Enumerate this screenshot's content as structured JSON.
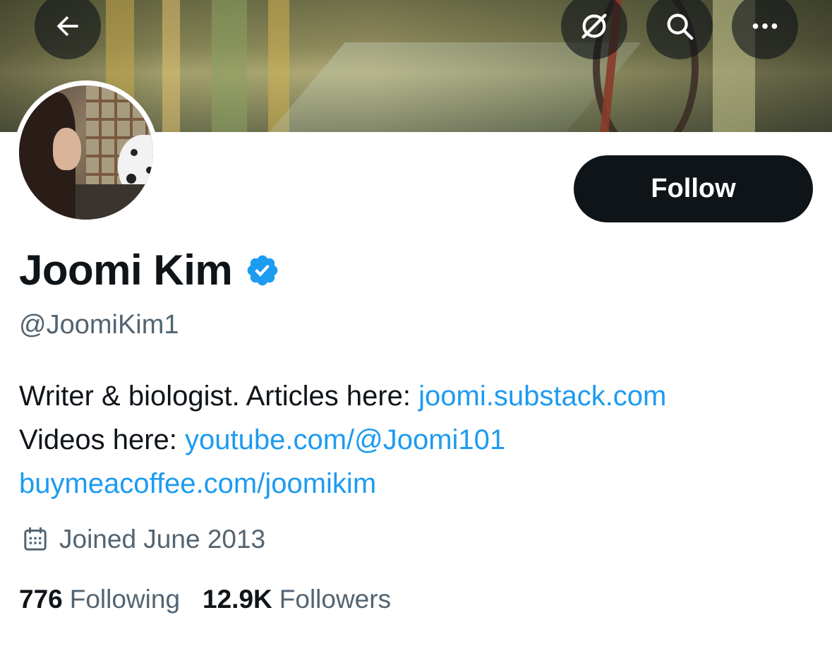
{
  "header": {
    "back_icon": "arrow-left-icon",
    "circle_icon": "no-notifications-icon",
    "search_icon": "search-icon",
    "more_icon": "more-horizontal-icon"
  },
  "profile": {
    "follow_label": "Follow",
    "display_name": "Joomi Kim",
    "verified_icon": "verified-badge-icon",
    "handle": "@JoomiKim1",
    "bio": {
      "line1_text": "Writer & biologist. Articles here: ",
      "line1_link": "joomi.substack.com",
      "line2_text": "Videos here: ",
      "line2_link": "youtube.com/@Joomi101",
      "line3_link": "buymeacoffee.com/joomikim"
    },
    "joined": "Joined June 2013",
    "following_count": "776",
    "following_label": "Following",
    "followers_count": "12.9K",
    "followers_label": "Followers"
  },
  "colors": {
    "accent": "#1d9bf0",
    "text_primary": "#0f1419",
    "text_secondary": "#536471",
    "button_bg": "#0f1419"
  }
}
